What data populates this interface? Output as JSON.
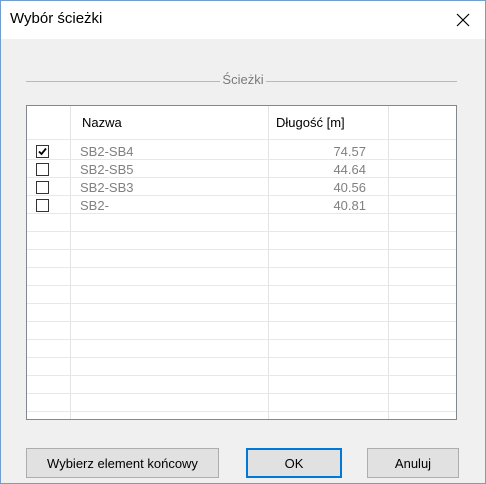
{
  "window": {
    "title": "Wybór ścieżki"
  },
  "group": {
    "label": "Ścieżki"
  },
  "table": {
    "columns": [
      "Nazwa",
      "Długość [m]"
    ],
    "rows": [
      {
        "checked": true,
        "name": "SB2-SB4",
        "length": "74.57"
      },
      {
        "checked": false,
        "name": "SB2-SB5",
        "length": "44.64"
      },
      {
        "checked": false,
        "name": "SB2-SB3",
        "length": "40.56"
      },
      {
        "checked": false,
        "name": "SB2-",
        "length": "40.81"
      }
    ]
  },
  "buttons": {
    "select_end": "Wybierz element końcowy",
    "ok": "OK",
    "cancel": "Anuluj"
  }
}
